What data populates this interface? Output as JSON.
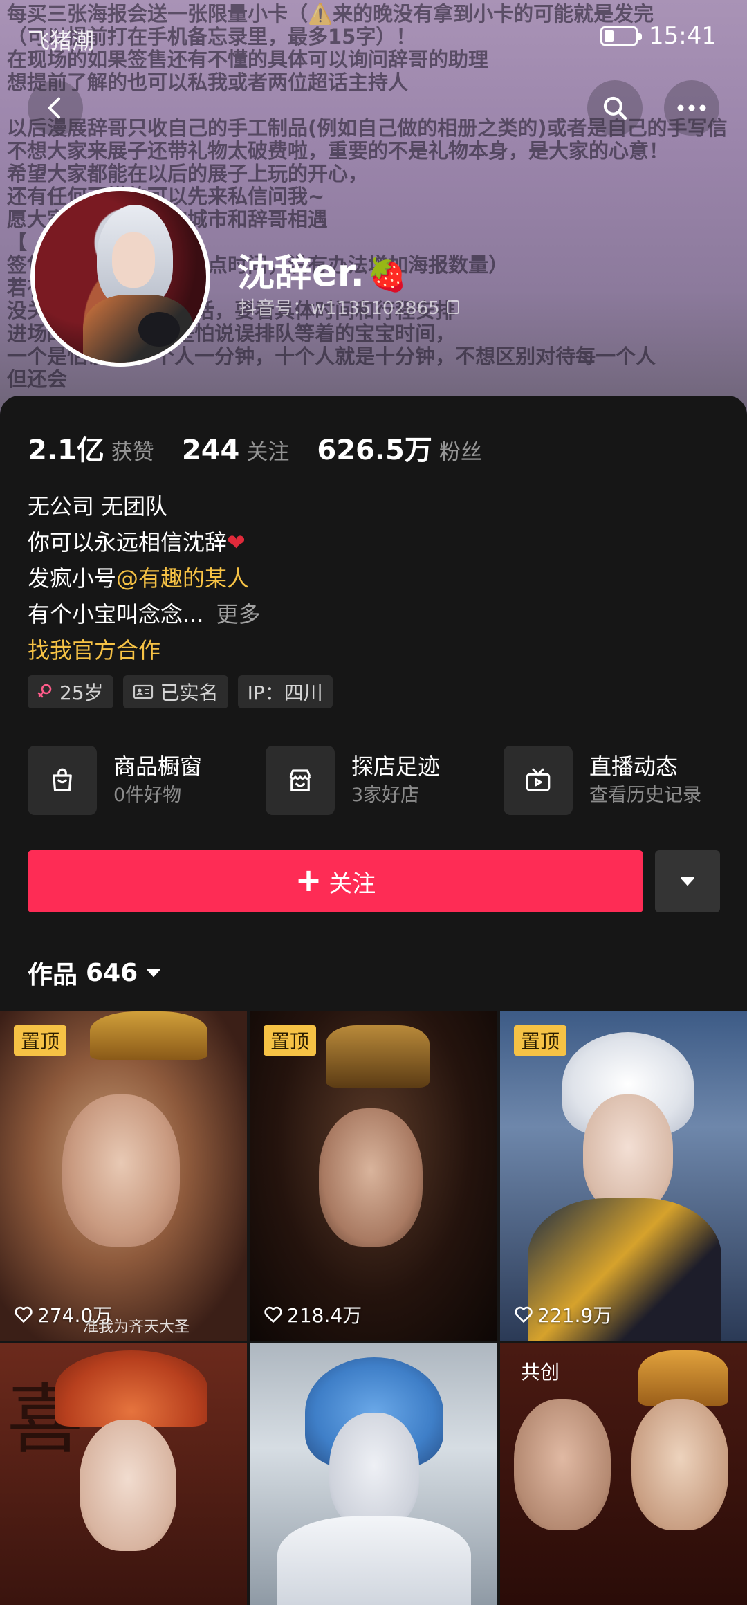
{
  "banner": {
    "text_lines": [
      "每买三张海报会送一张限量小卡（⚠️来的晚没有拿到小卡的可能就是发完",
      "（可以提前打在手机备忘录里，最多15字）！",
      "在现场的如果签售还有不懂的具体可以询问辞哥的助理",
      "想提前了解的也可以私我或者两位超话主持人",
      "",
      "以后漫展辞哥只收自己的手工制品(例如自己做的相册之类的)或者是自己的手写信",
      "不想大家来展子还带礼物太破费啦，重要的不是礼物本身，是大家的心意！",
      "希望大家都能在以后的展子上玩的开心，",
      "还有任何不懂的可以先来私信问我~",
      "愿大家都能在自己的城市和辞哥相遇",
      "【",
      "签售（排签的会全多一点时间，没有办法增加海报数量）",
      "若有",
      "没关系 宝宝想合照的话，要看具体时间和行程安排",
      "进场的 合照（一个是怕说误排队等着的宝宝时间，",
      "一个是怕误伤 一个人一分钟，十个人就是十分钟，不想区别对待每一个人",
      "但还会"
    ]
  },
  "status_bar": {
    "left_text": "飞猪潮",
    "time": "15:41",
    "battery_level": 0.3
  },
  "profile": {
    "nickname": "沈辞er.",
    "nickname_emoji": "🍓",
    "account_id": "抖音号：w1135102865"
  },
  "stats": {
    "likes_count": "2.1亿",
    "likes_label": "获赞",
    "following_count": "244",
    "following_label": "关注",
    "followers_count": "626.5万",
    "followers_label": "粉丝"
  },
  "bio": {
    "line1": "无公司 无团队",
    "line2_text": "你可以永远相信沈辞",
    "line2_emoji": "❤",
    "line3_prefix": "发疯小号",
    "line3_mention": "@有趣的某人",
    "line4_text": "有个小宝叫念念...",
    "line4_more": "更多",
    "official_link": "找我官方合作"
  },
  "tags": [
    {
      "icon": "female-icon",
      "label": "25岁"
    },
    {
      "icon": "id-card-icon",
      "label": "已实名"
    },
    {
      "icon": "",
      "label": "IP：四川"
    }
  ],
  "features": [
    {
      "icon": "shopping-bag-icon",
      "title": "商品橱窗",
      "subtitle": "0件好物"
    },
    {
      "icon": "store-icon",
      "title": "探店足迹",
      "subtitle": "3家好店"
    },
    {
      "icon": "tv-icon",
      "title": "直播动态",
      "subtitle": "查看历史记录"
    }
  ],
  "actions": {
    "follow_label": "关注",
    "follow_color": "#fe2c55"
  },
  "works": {
    "label": "作品",
    "count": "646"
  },
  "grid": [
    {
      "badge": "置顶",
      "likes": "274.0万",
      "caption": "准我为齐天大圣"
    },
    {
      "badge": "置顶",
      "likes": "218.4万",
      "caption": ""
    },
    {
      "badge": "置顶",
      "likes": "221.9万",
      "caption": ""
    },
    {
      "badge": "",
      "likes": "",
      "caption": ""
    },
    {
      "badge": "",
      "likes": "",
      "caption": ""
    },
    {
      "badge": "共创",
      "likes": "",
      "caption": ""
    }
  ],
  "colors": {
    "accent_yellow": "#f6c245",
    "follow_red": "#fe2c55",
    "background": "#161616"
  }
}
